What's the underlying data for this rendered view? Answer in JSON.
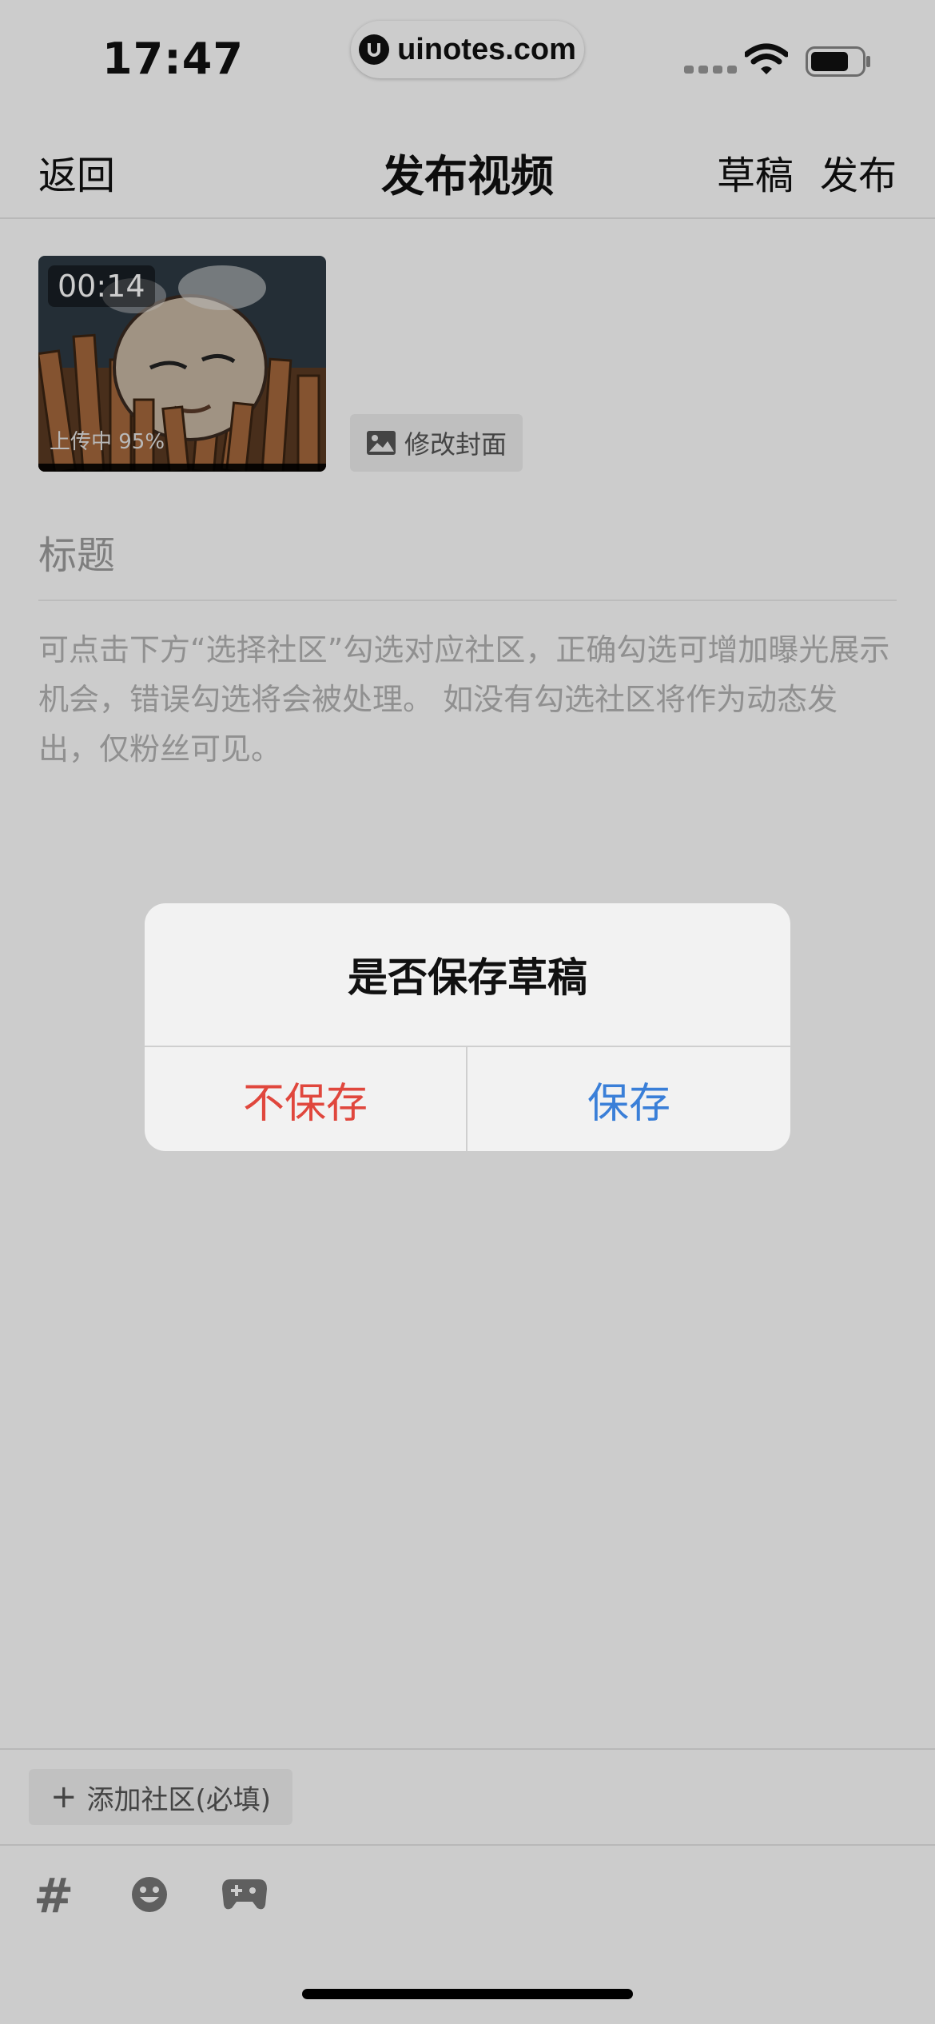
{
  "status_bar": {
    "time": "17:47",
    "site": "uinotes.com"
  },
  "nav": {
    "back_label": "返回",
    "title": "发布视频",
    "draft_label": "草稿",
    "publish_label": "发布"
  },
  "video": {
    "duration": "00:14",
    "upload_status": "上传中 95%",
    "upload_progress_percent": 95,
    "change_cover_label": "修改封面"
  },
  "form": {
    "title_placeholder": "标题",
    "description_placeholder": "可点击下方“选择社区”勾选对应社区，正确勾选可增加曝光展示机会，错误勾选将会被处理。 如没有勾选社区将作为动态发出，仅粉丝可见。"
  },
  "community": {
    "add_label": "添加社区(必填)"
  },
  "toolbar": {
    "icons": [
      "hashtag-icon",
      "emoji-icon",
      "game-controller-icon"
    ],
    "hash_glyph": "#"
  },
  "dialog": {
    "title": "是否保存草稿",
    "discard_label": "不保存",
    "save_label": "保存",
    "colors": {
      "discard": "#e0473d",
      "save": "#3a7fd8"
    }
  }
}
